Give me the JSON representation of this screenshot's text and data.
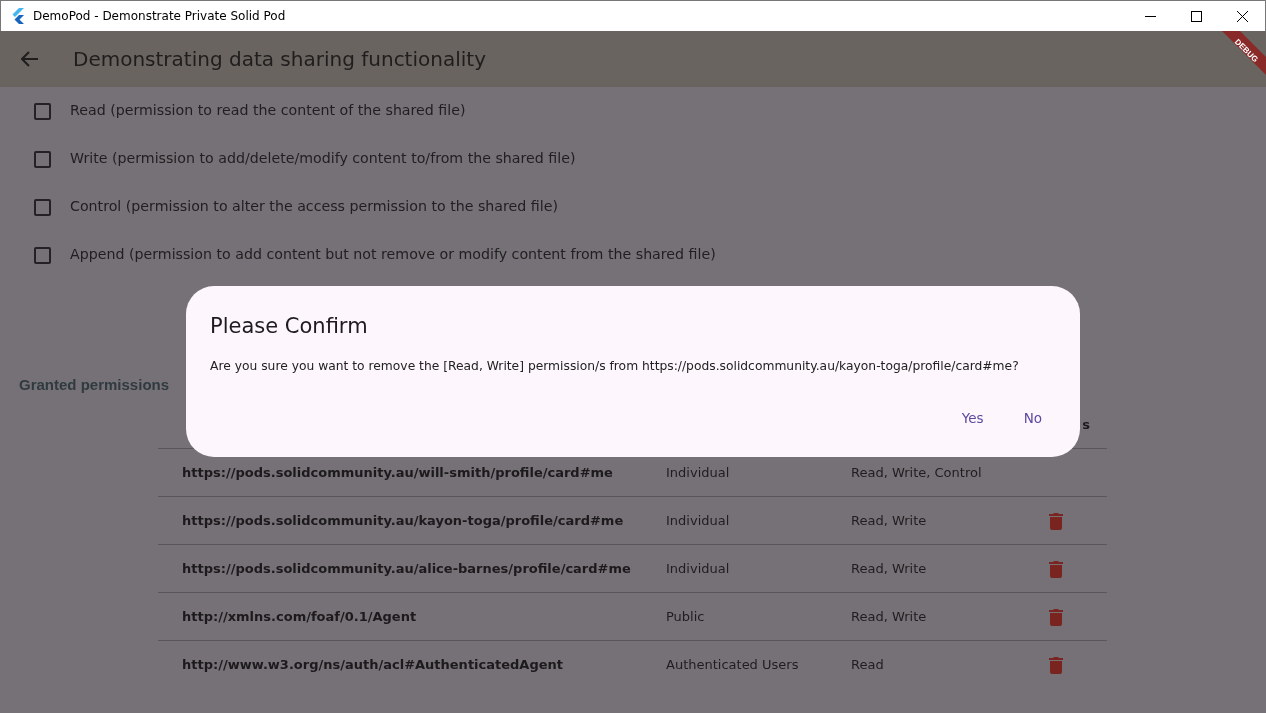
{
  "window": {
    "title": "DemoPod - Demonstrate Private Solid Pod"
  },
  "app_bar": {
    "title": "Demonstrating data sharing functionality"
  },
  "debug_banner": "DEBUG",
  "permissions": [
    {
      "label": "Read (permission to read the content of the shared file)",
      "checked": false
    },
    {
      "label": "Write (permission to add/delete/modify content to/from the shared file)",
      "checked": false
    },
    {
      "label": "Control (permission to alter the access permission to the shared file)",
      "checked": false
    },
    {
      "label": "Append (permission to add content but not remove or modify content from the shared file)",
      "checked": false
    }
  ],
  "granted": {
    "heading": "Granted permissions",
    "column_4": "s",
    "rows": [
      {
        "receiver": "https://pods.solidcommunity.au/will-smith/profile/card#me",
        "type": "Individual",
        "permissions": "Read, Write, Control",
        "deletable": false
      },
      {
        "receiver": "https://pods.solidcommunity.au/kayon-toga/profile/card#me",
        "type": "Individual",
        "permissions": "Read, Write",
        "deletable": true
      },
      {
        "receiver": "https://pods.solidcommunity.au/alice-barnes/profile/card#me",
        "type": "Individual",
        "permissions": "Read, Write",
        "deletable": true
      },
      {
        "receiver": "http://xmlns.com/foaf/0.1/Agent",
        "type": "Public",
        "permissions": "Read, Write",
        "deletable": true
      },
      {
        "receiver": "http://www.w3.org/ns/auth/acl#AuthenticatedAgent",
        "type": "Authenticated Users",
        "permissions": "Read",
        "deletable": true
      }
    ]
  },
  "dialog": {
    "title": "Please Confirm",
    "message": "Are you sure you want to remove the [Read, Write] permission/s from https://pods.solidcommunity.au/kayon-toga/profile/card#me?",
    "buttons": [
      "Yes",
      "No"
    ]
  }
}
